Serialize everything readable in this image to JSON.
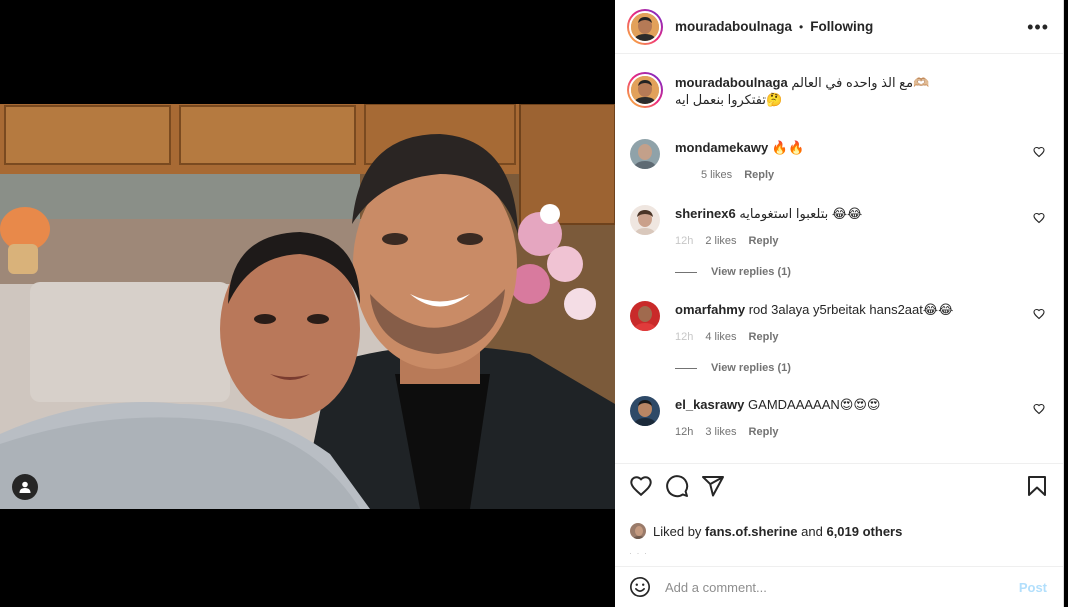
{
  "post": {
    "author": "mouradaboulnaga",
    "separator": "•",
    "follow_status": "Following",
    "more_label": "•••",
    "caption": "مع الذ واحده في العالم🫶 تفتكروا بنعمل ايه🤔",
    "caption_line1": "مع الذ واحده في العالم",
    "caption_line1_emoji": "🫶🏼",
    "caption_line2": "تفتكروا بنعمل ايه",
    "caption_line2_emoji": "🤔"
  },
  "comments": [
    {
      "user": "mondamekawy",
      "text": "🔥🔥",
      "time": "",
      "likes": "5 likes",
      "reply": "Reply",
      "view_replies": ""
    },
    {
      "user": "sherinex6",
      "text": "بتلعبوا استغومايه 😂😂",
      "time": "12h",
      "likes": "2 likes",
      "reply": "Reply",
      "view_replies": "View replies (1)"
    },
    {
      "user": "omarfahmy",
      "text": "rod 3alaya y5rbeitak hans2aat😂😂",
      "time": "12h",
      "likes": "4 likes",
      "reply": "Reply",
      "view_replies": "View replies (1)"
    },
    {
      "user": "el_kasrawy",
      "text": "GAMDAAAAAN😍😍😍",
      "time": "12h",
      "likes": "3 likes",
      "reply": "Reply",
      "view_replies": ""
    }
  ],
  "likes": {
    "prefix": "Liked by",
    "user": "fans.of.sherine",
    "and": "and",
    "others": "6,019 others"
  },
  "date_text": "· · ·",
  "add_comment": {
    "placeholder": "Add a comment...",
    "post_label": "Post"
  },
  "icons": {
    "like": "heart-icon",
    "comment": "comment-bubble-icon",
    "share": "paper-plane-icon",
    "save": "bookmark-icon",
    "emoji": "smiley-icon",
    "tag": "user-tag-icon"
  },
  "colors": {
    "post_button": "#b2dffc",
    "muted": "#737373",
    "text": "#262626"
  }
}
